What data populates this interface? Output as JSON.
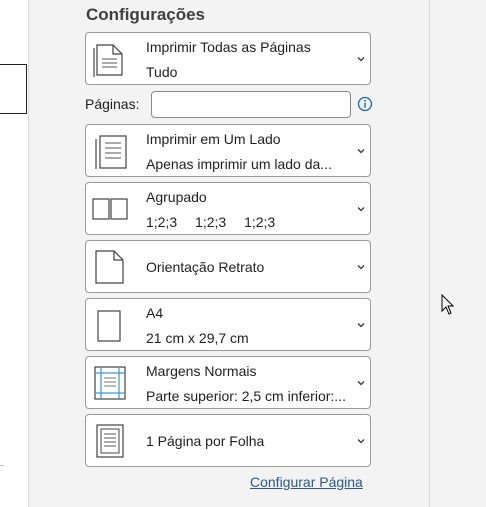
{
  "section_title": "Configurações",
  "settings": {
    "print_range": {
      "title": "Imprimir Todas as Páginas",
      "subtitle": "Tudo",
      "icon": "pages-stack-icon"
    },
    "pages": {
      "label": "Páginas:",
      "value": "",
      "placeholder": "",
      "icon": "info-icon"
    },
    "sides": {
      "title": "Imprimir em Um Lado",
      "subtitle": "Apenas imprimir um lado da...",
      "icon": "one-sided-print-icon"
    },
    "collate": {
      "title": "Agrupado",
      "sequence": [
        "1;2;3",
        "1;2;3",
        "1;2;3"
      ],
      "icon": "collated-icon"
    },
    "orientation": {
      "title": "Orientação Retrato",
      "icon": "portrait-page-icon"
    },
    "paper_size": {
      "title": "A4",
      "subtitle": "21 cm x 29,7 cm",
      "icon": "paper-size-icon"
    },
    "margins": {
      "title": "Margens Normais",
      "subtitle": "Parte superior: 2,5 cm inferior:...",
      "icon": "margins-icon"
    },
    "pages_per_sheet": {
      "title": "1 Página por Folha",
      "icon": "pages-per-sheet-icon"
    }
  },
  "page_setup_link": "Configurar Página",
  "colors": {
    "accent": "#2b579a",
    "info": "#0f6cbd",
    "margin_guides": "#3a96dd"
  }
}
